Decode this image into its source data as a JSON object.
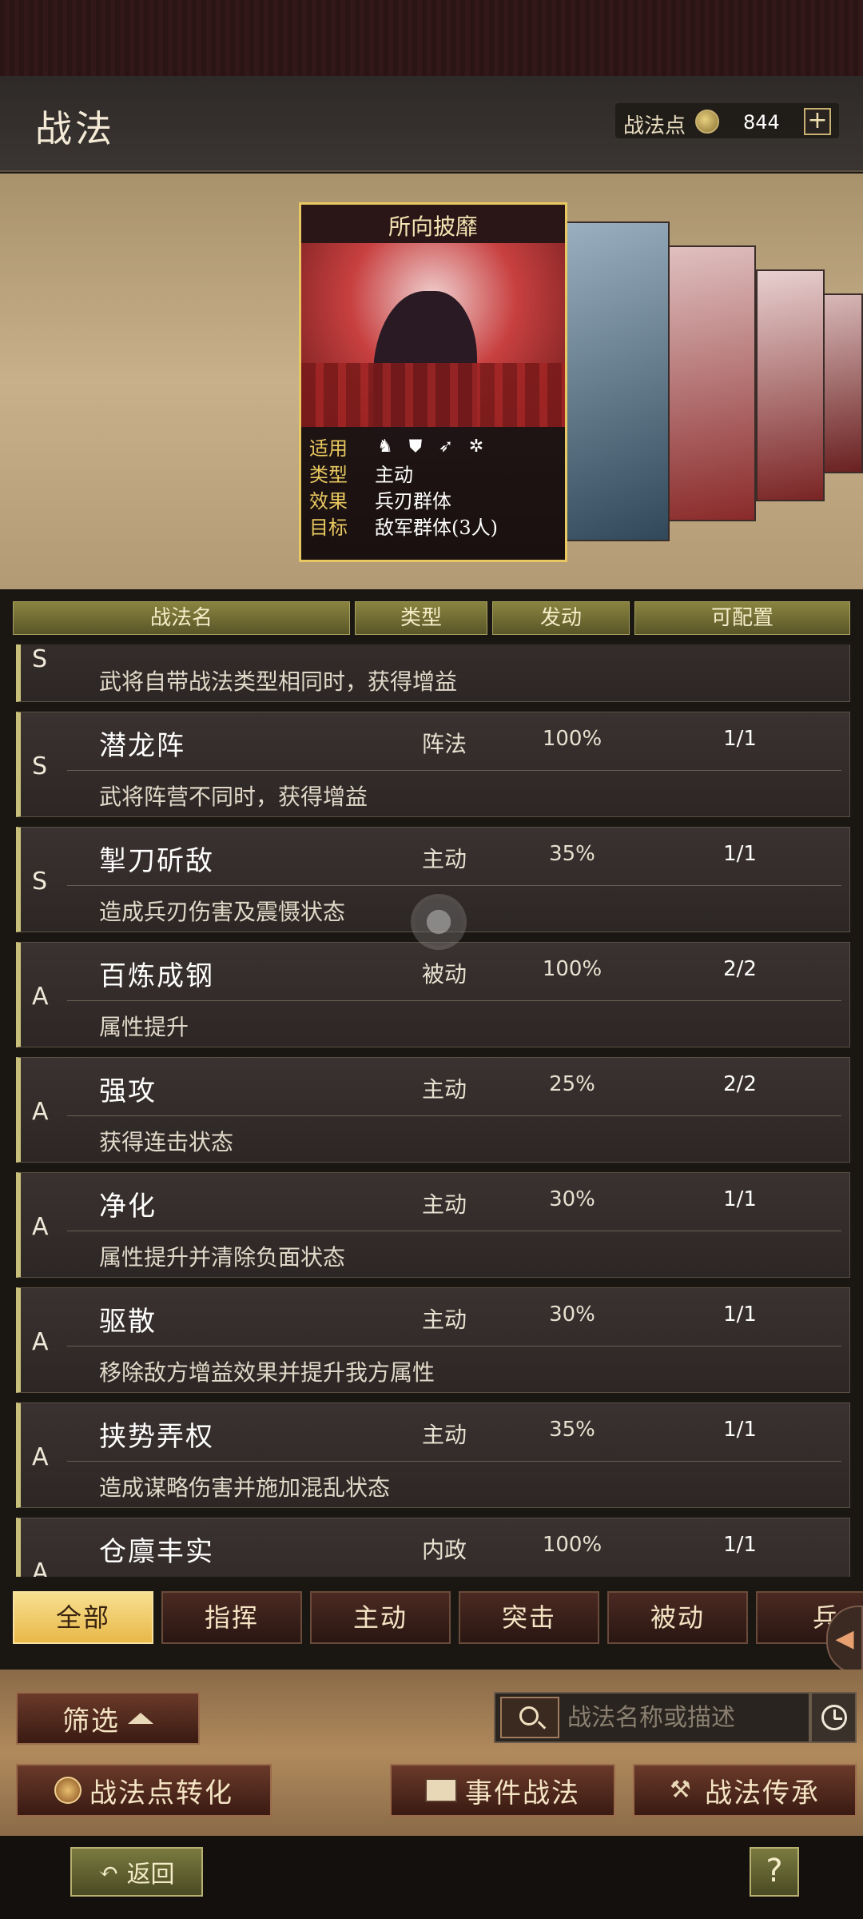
{
  "header": {
    "title": "战法",
    "points_label": "战法点",
    "points_value": "844",
    "add_label": "+"
  },
  "featured": {
    "name": "所向披靡",
    "rows": [
      {
        "key": "适用",
        "value": ""
      },
      {
        "key": "类型",
        "value": "主动"
      },
      {
        "key": "效果",
        "value": "兵刃群体"
      },
      {
        "key": "目标",
        "value": "敌军群体(3人)"
      }
    ],
    "applicable_icons": [
      "cavalry-icon",
      "shield-icon",
      "bow-icon",
      "wheel-icon"
    ]
  },
  "table": {
    "headers": [
      "战法名",
      "类型",
      "发动",
      "可配置"
    ]
  },
  "skills": [
    {
      "grade": "S",
      "name": "",
      "type": "",
      "rate": "",
      "config": "",
      "desc": "武将自带战法类型相同时，获得增益"
    },
    {
      "grade": "S",
      "name": "潜龙阵",
      "type": "阵法",
      "rate": "100%",
      "config": "1/1",
      "desc": "武将阵营不同时，获得增益"
    },
    {
      "grade": "S",
      "name": "掣刀斫敌",
      "type": "主动",
      "rate": "35%",
      "config": "1/1",
      "desc": "造成兵刃伤害及震慑状态"
    },
    {
      "grade": "A",
      "name": "百炼成钢",
      "type": "被动",
      "rate": "100%",
      "config": "2/2",
      "desc": "属性提升"
    },
    {
      "grade": "A",
      "name": "强攻",
      "type": "主动",
      "rate": "25%",
      "config": "2/2",
      "desc": "获得连击状态"
    },
    {
      "grade": "A",
      "name": "净化",
      "type": "主动",
      "rate": "30%",
      "config": "1/1",
      "desc": "属性提升并清除负面状态"
    },
    {
      "grade": "A",
      "name": "驱散",
      "type": "主动",
      "rate": "30%",
      "config": "1/1",
      "desc": "移除敌方增益效果并提升我方属性"
    },
    {
      "grade": "A",
      "name": "挟势弄权",
      "type": "主动",
      "rate": "35%",
      "config": "1/1",
      "desc": "造成谋略伤害并施加混乱状态"
    },
    {
      "grade": "A",
      "name": "仓廪丰实",
      "type": "内政",
      "rate": "100%",
      "config": "1/1",
      "desc": ""
    }
  ],
  "tabs": [
    "全部",
    "指挥",
    "主动",
    "突击",
    "被动",
    "兵"
  ],
  "bottom": {
    "filter_label": "筛选",
    "search_placeholder": "战法名称或描述",
    "convert_label": "战法点转化",
    "event_label": "事件战法",
    "inherit_label": "战法传承"
  },
  "footer": {
    "back_label": "返回",
    "help_label": "?"
  }
}
